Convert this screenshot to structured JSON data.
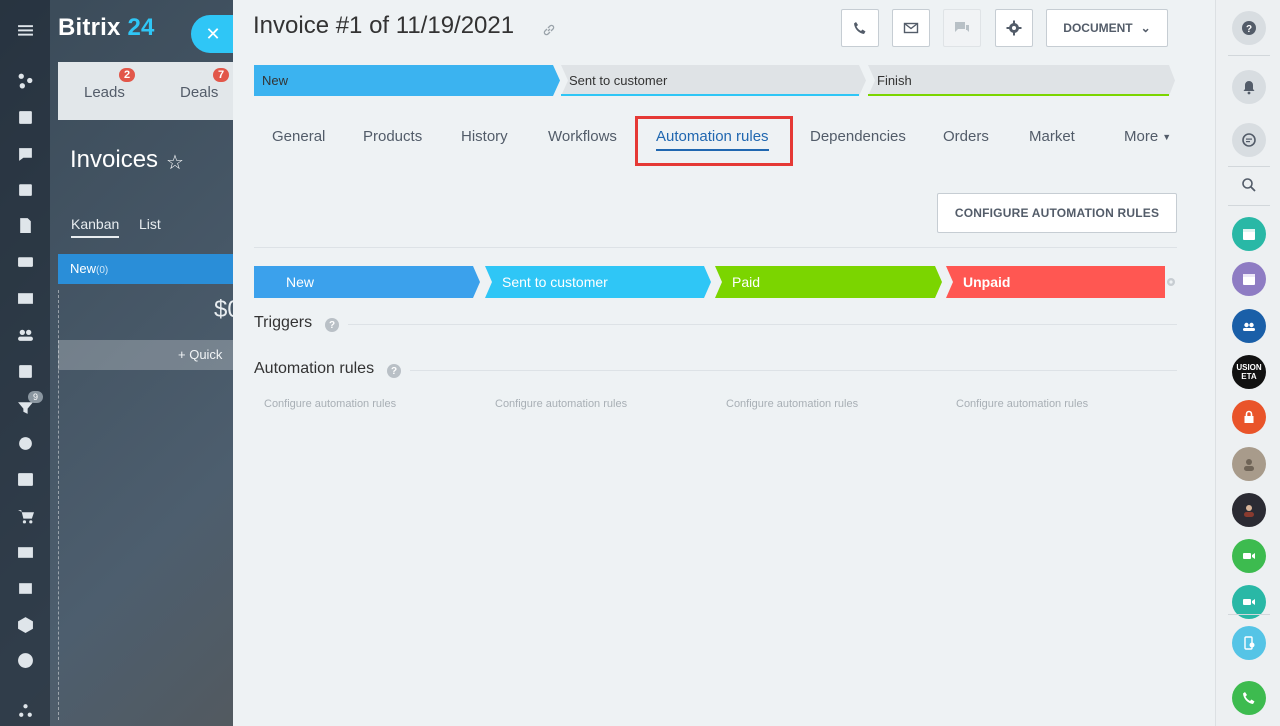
{
  "brand": {
    "name": "Bitrix",
    "number": "24"
  },
  "background": {
    "tabs": [
      {
        "label": "Leads",
        "count": "2"
      },
      {
        "label": "Deals",
        "count": "7"
      }
    ],
    "title": "Invoices",
    "views": [
      "Kanban",
      "List"
    ],
    "column": {
      "name": "New",
      "count": "(0)"
    },
    "sum": "$0",
    "quick_add": "+ Quick"
  },
  "left_rail": {
    "badge": "9"
  },
  "invoice": {
    "title": "Invoice #1 of 11/19/2021",
    "document_button": "DOCUMENT",
    "stages": [
      {
        "label": "New",
        "color": "#3bb3f0"
      },
      {
        "label": "Sent to customer",
        "color": "#dfe3e6"
      },
      {
        "label": "Finish",
        "color": "#dfe3e6"
      }
    ],
    "tabs": [
      "General",
      "Products",
      "History",
      "Workflows",
      "Automation rules",
      "Dependencies",
      "Orders",
      "Market",
      "More"
    ],
    "active_tab": "Automation rules"
  },
  "automation": {
    "configure_button": "CONFIGURE AUTOMATION RULES",
    "stages": [
      {
        "label": "New",
        "color": "#3ba1ec"
      },
      {
        "label": "Sent to customer",
        "color": "#2fc6f6"
      },
      {
        "label": "Paid",
        "color": "#7bd500"
      },
      {
        "label": "Unpaid",
        "color": "#ff5752"
      }
    ],
    "triggers_label": "Triggers",
    "rules_label": "Automation rules",
    "configure_links": [
      "Configure automation rules",
      "Configure automation rules",
      "Configure automation rules",
      "Configure automation rules"
    ]
  },
  "right_rail": {
    "avatar_text": "USION ETA"
  }
}
